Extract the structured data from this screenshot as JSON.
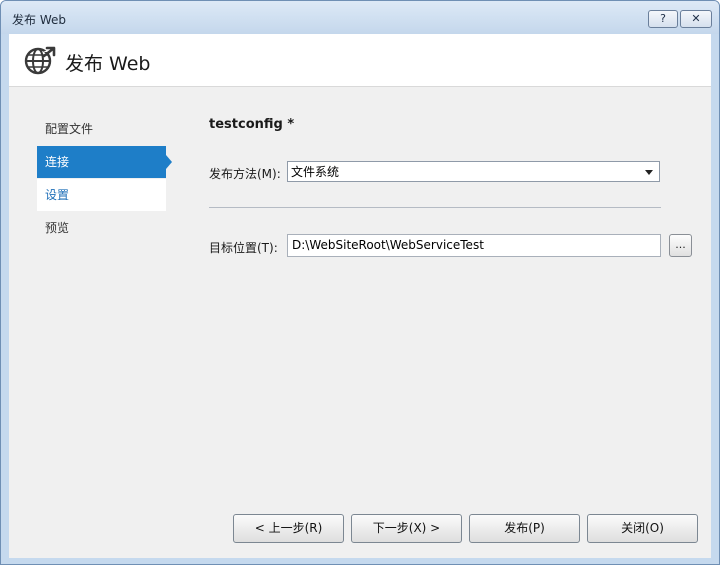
{
  "window": {
    "title": "发布 Web",
    "help_label": "?",
    "close_label": "✕"
  },
  "header": {
    "title": "发布 Web",
    "icon": "globe-publish-icon"
  },
  "nav": {
    "items": [
      {
        "label": "配置文件",
        "state": "normal"
      },
      {
        "label": "连接",
        "state": "active"
      },
      {
        "label": "设置",
        "state": "sub"
      },
      {
        "label": "预览",
        "state": "normal"
      }
    ]
  },
  "main": {
    "profile_name": "testconfig *",
    "method_label": "发布方法(M):",
    "method_value": "文件系统",
    "target_label": "目标位置(T):",
    "target_value": "D:\\WebSiteRoot\\WebServiceTest",
    "browse_label": "..."
  },
  "footer": {
    "prev_label": "< 上一步(R)",
    "next_label": "下一步(X) >",
    "publish_label": "发布(P)",
    "close_label": "关闭(O)"
  },
  "colors": {
    "accent": "#1e7ec8",
    "titlebar": "#c4d7ec"
  }
}
